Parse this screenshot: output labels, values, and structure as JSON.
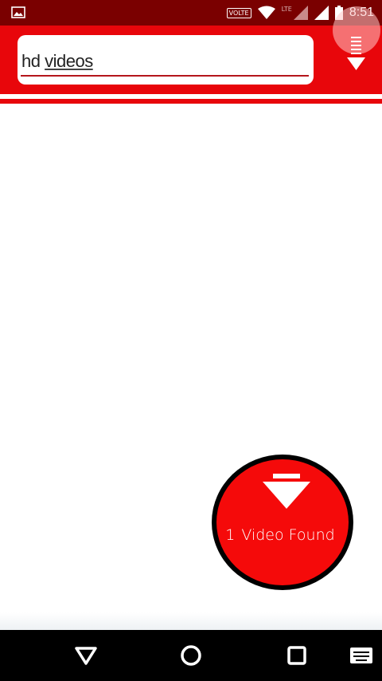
{
  "status_bar": {
    "time": "8:51",
    "network_type": "LTE",
    "badge": "VOLTE",
    "icons": [
      "image-notification-icon",
      "wifi-icon",
      "signal-icon",
      "battery-icon"
    ]
  },
  "search": {
    "query_part1": "hd",
    "query_part2": "videos"
  },
  "toolbar": {
    "menu_icon": "download-list-icon"
  },
  "download_badge": {
    "count": "1",
    "label": "Video Found",
    "icon": "download-arrow-icon"
  },
  "nav_bar": {
    "buttons": [
      "back-icon",
      "home-icon",
      "recents-icon",
      "keyboard-icon"
    ]
  },
  "colors": {
    "primary": "#e8060b",
    "status_bar": "#7a0000",
    "badge_fill": "#f50a0a",
    "badge_border": "#000000"
  }
}
